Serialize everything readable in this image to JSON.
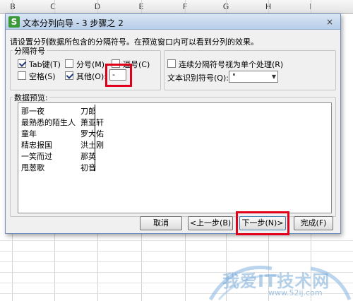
{
  "spreadsheet": {
    "columns": [
      "B",
      "C",
      "D",
      "E",
      "F",
      "G",
      "H",
      "I"
    ]
  },
  "dialog": {
    "title": "文本分列向导 - 3 步骤之 2",
    "app_icon_glyph": "S",
    "close_glyph": "×",
    "instruction": "请设置分列数据所包含的分隔符号。在预览窗口内可以看到分列的效果。",
    "delimiters": {
      "group_label": "分隔符号",
      "tab": {
        "label": "Tab键(T)",
        "checked": true
      },
      "semicolon": {
        "label": "分号(M)",
        "checked": false
      },
      "comma": {
        "label": "逗号(C)",
        "checked": false
      },
      "space": {
        "label": "空格(S)",
        "checked": false
      },
      "other": {
        "label": "其他(O):",
        "checked": true,
        "value": "-"
      }
    },
    "options": {
      "consecutive": {
        "label": "连续分隔符号视为单个处理(R)",
        "checked": false
      },
      "text_qualifier_label": "文本识别符号(Q):",
      "text_qualifier_value": "\""
    },
    "preview": {
      "group_label": "数据预览:",
      "rows": [
        [
          "那一夜",
          "刀郎"
        ],
        [
          "最熟悉的陌生人",
          "萧亚轩"
        ],
        [
          "童年",
          "罗大佑"
        ],
        [
          "精忠报国",
          "洪土刚"
        ],
        [
          "一笑而过",
          "那英"
        ],
        [
          "甩葱歌",
          "初音"
        ]
      ]
    },
    "buttons": {
      "cancel": "取消",
      "back": "<上一步(B)",
      "next": "下一步(N)>",
      "finish": "完成(F)"
    }
  },
  "watermark": {
    "text": "我爱IT技术网",
    "url": "www.52ij.com"
  },
  "colors": {
    "highlight": "#e0001b",
    "dialog_bg": "#f0f0f0",
    "title_gradient_top": "#d9e6f5"
  }
}
